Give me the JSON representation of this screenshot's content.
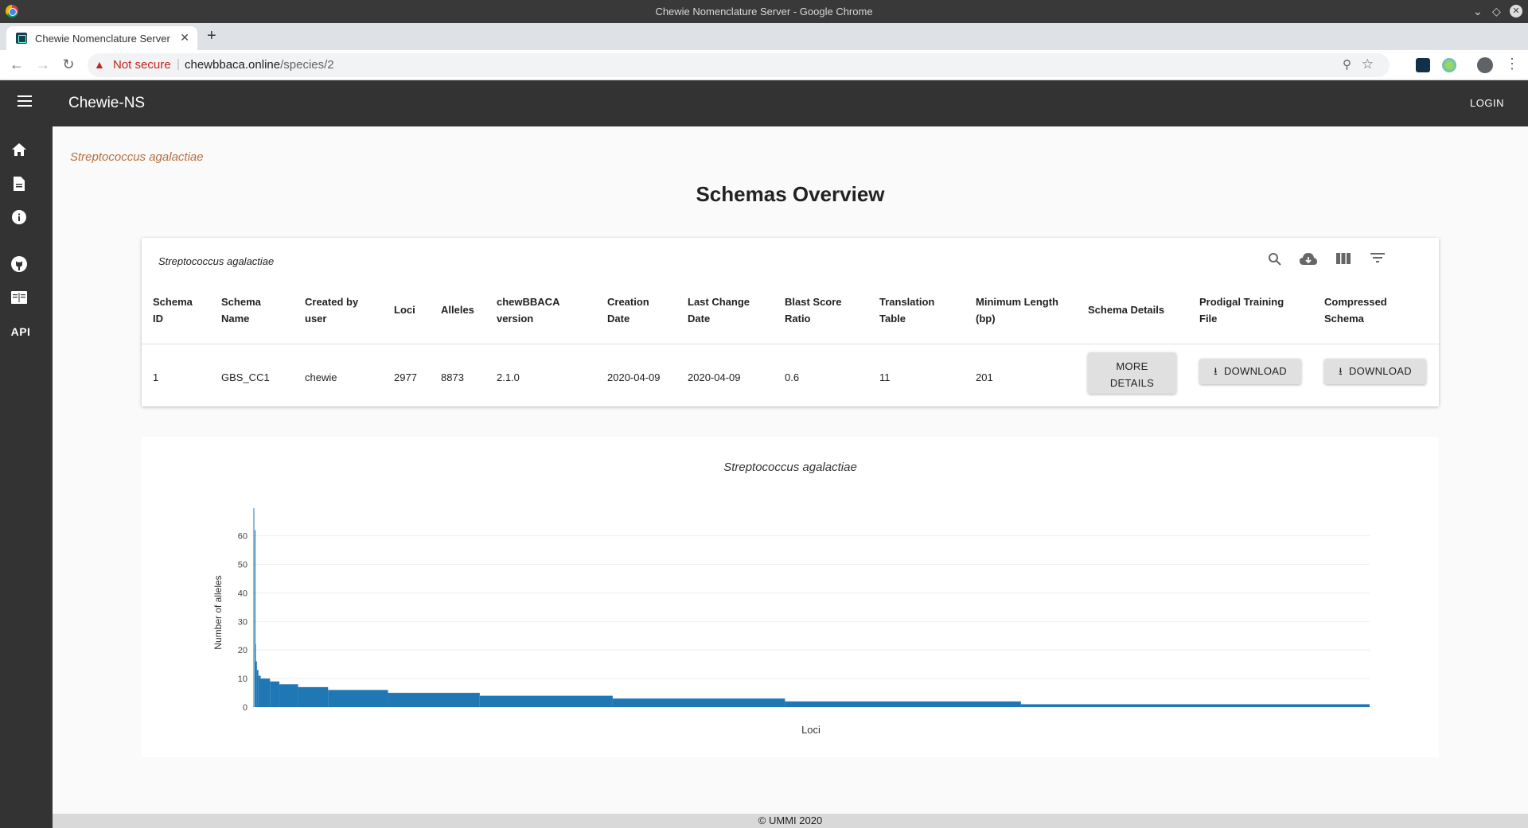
{
  "browser": {
    "window_title": "Chewie Nomenclature Server - Google Chrome",
    "tab_title": "Chewie Nomenclature Server",
    "security_label": "Not secure",
    "url_host": "chewbbaca.online",
    "url_path": "/species/2"
  },
  "app": {
    "title": "Chewie-NS",
    "login_label": "LOGIN",
    "drawer_items": [
      "home-icon",
      "document-icon",
      "info-icon",
      "github-icon",
      "book-icon",
      "api-icon"
    ],
    "api_label": "API"
  },
  "page": {
    "breadcrumb": "Streptococcus agalactiae",
    "heading": "Schemas Overview"
  },
  "table": {
    "title": "Streptococcus agalactiae",
    "columns": [
      [
        "Schema",
        "ID"
      ],
      [
        "Schema",
        "Name"
      ],
      [
        "Created by",
        "user"
      ],
      [
        "Loci"
      ],
      [
        "Alleles"
      ],
      [
        "chewBBACA",
        "version"
      ],
      [
        "Creation",
        "Date"
      ],
      [
        "Last Change",
        "Date"
      ],
      [
        "Blast Score",
        "Ratio"
      ],
      [
        "Translation",
        "Table"
      ],
      [
        "Minimum Length",
        "(bp)"
      ],
      [
        "Schema Details"
      ],
      [
        "Prodigal Training",
        "File"
      ],
      [
        "Compressed",
        "Schema"
      ]
    ],
    "row": [
      "1",
      "GBS_CC1",
      "chewie",
      "2977",
      "8873",
      "2.1.0",
      "2020-04-09",
      "2020-04-09",
      "0.6",
      "11",
      "201"
    ],
    "more_details_label": [
      "MORE",
      "DETAILS"
    ],
    "download_label": "DOWNLOAD"
  },
  "chart_data": {
    "type": "bar",
    "title": "Streptococcus agalactiae",
    "xlabel": "Loci",
    "ylabel": "Number of alleles",
    "ylim": [
      0,
      63
    ],
    "yticks": [
      0,
      10,
      20,
      30,
      40,
      50,
      60
    ],
    "n_categories": 2977,
    "color": "#1f77b4",
    "values_by_rank_segments": [
      {
        "count": 1,
        "value": 62
      },
      {
        "count": 2,
        "value": 22
      },
      {
        "count": 3,
        "value": 16
      },
      {
        "count": 4,
        "value": 13
      },
      {
        "count": 6,
        "value": 11
      },
      {
        "count": 25,
        "value": 10
      },
      {
        "count": 25,
        "value": 9
      },
      {
        "count": 50,
        "value": 8
      },
      {
        "count": 80,
        "value": 7
      },
      {
        "count": 160,
        "value": 6
      },
      {
        "count": 245,
        "value": 5
      },
      {
        "count": 355,
        "value": 4
      },
      {
        "count": 460,
        "value": 3
      },
      {
        "count": 630,
        "value": 2
      },
      {
        "count": 931,
        "value": 1
      }
    ]
  },
  "footer": "© UMMI 2020",
  "colors": {
    "appbar": "#333333",
    "breadcrumb": "#b86e3c",
    "bar": "#1f77b4",
    "warning": "#c5221f"
  }
}
